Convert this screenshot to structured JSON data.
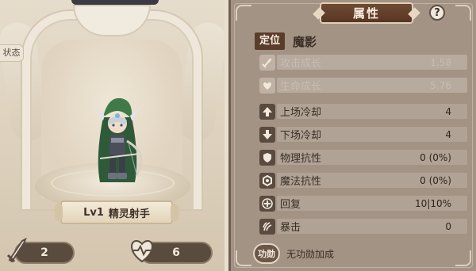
{
  "left": {
    "status_tab": "状态",
    "hero": {
      "level": "Lv1",
      "name": "精灵射手"
    },
    "attack_value": "2",
    "hp_value": "6"
  },
  "right": {
    "title": "属性",
    "help": "?",
    "role_label": "定位",
    "role_value": "魔影",
    "stats": [
      {
        "icon": "sword-icon",
        "label": "攻击成长",
        "value": "1.58",
        "growth": true
      },
      {
        "icon": "heart-icon",
        "label": "生命成长",
        "value": "5.76",
        "growth": true
      },
      {
        "icon": "arrow-up-icon",
        "label": "上场冷却",
        "value": "4",
        "growth": false
      },
      {
        "icon": "arrow-down-icon",
        "label": "下场冷却",
        "value": "4",
        "growth": false
      },
      {
        "icon": "shield-icon",
        "label": "物理抗性",
        "value": "0 (0%)",
        "growth": false
      },
      {
        "icon": "magic-shield-icon",
        "label": "魔法抗性",
        "value": "0 (0%)",
        "growth": false
      },
      {
        "icon": "plus-circle-icon",
        "label": "回复",
        "value": "10|10%",
        "growth": false
      },
      {
        "icon": "claw-icon",
        "label": "暴击",
        "value": "0",
        "growth": false
      }
    ],
    "merit_badge": "功勋",
    "merit_text": "无功勋加成"
  }
}
